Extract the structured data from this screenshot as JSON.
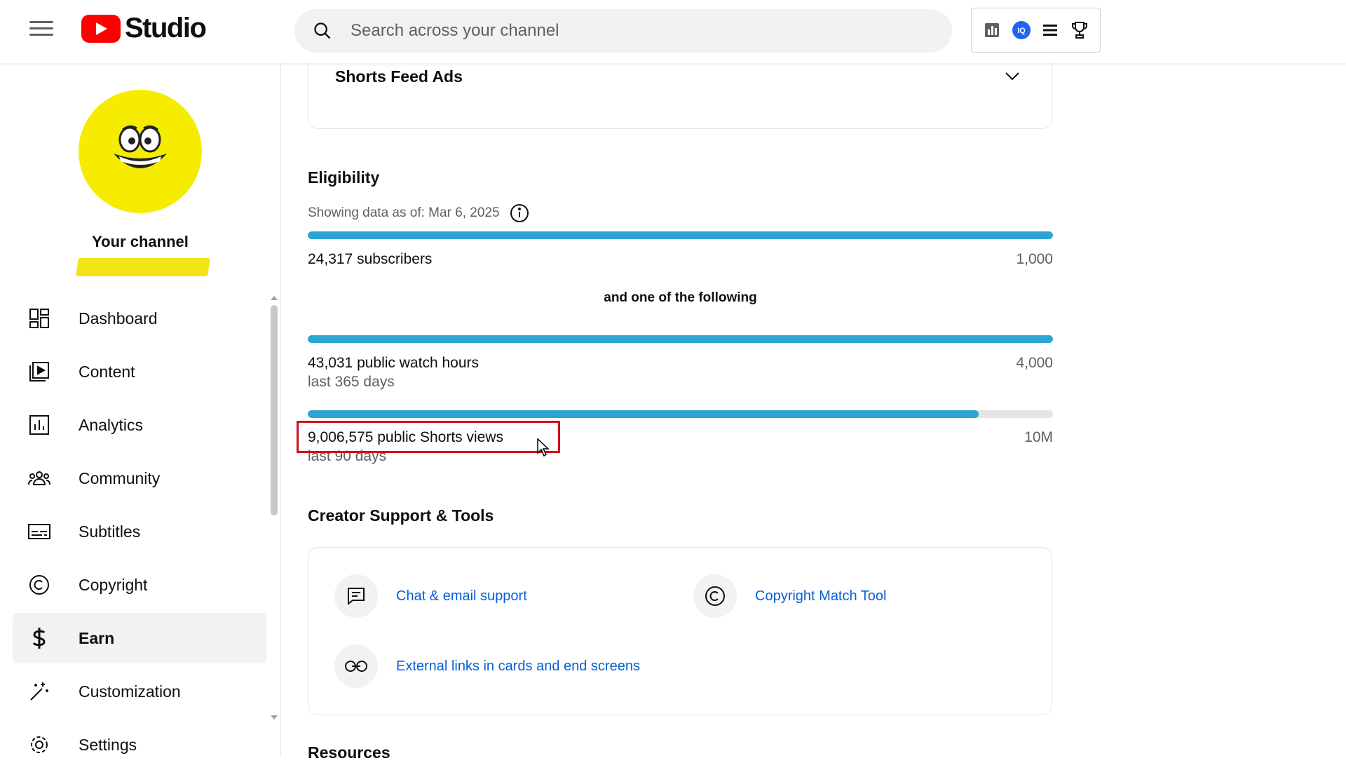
{
  "header": {
    "logo_text": "Studio",
    "search_placeholder": "Search across your channel",
    "extensions": [
      "analytics-chart-icon",
      "vidiq-icon",
      "list-icon",
      "trophy-icon"
    ]
  },
  "sidebar": {
    "channel_label": "Your channel",
    "items": [
      {
        "label": "Dashboard",
        "icon": "dashboard-icon"
      },
      {
        "label": "Content",
        "icon": "content-icon"
      },
      {
        "label": "Analytics",
        "icon": "analytics-icon"
      },
      {
        "label": "Community",
        "icon": "community-icon"
      },
      {
        "label": "Subtitles",
        "icon": "subtitles-icon"
      },
      {
        "label": "Copyright",
        "icon": "copyright-icon"
      },
      {
        "label": "Earn",
        "icon": "dollar-icon",
        "active": true
      },
      {
        "label": "Customization",
        "icon": "magic-wand-icon"
      },
      {
        "label": "Settings",
        "icon": "gear-icon"
      }
    ]
  },
  "main": {
    "shorts_feed_title": "Shorts Feed Ads",
    "eligibility": {
      "title": "Eligibility",
      "as_of": "Showing data as of: Mar 6, 2025",
      "following_label": "and one of the following",
      "metrics": [
        {
          "value_text": "24,317 subscribers",
          "sub": "",
          "target": "1,000",
          "progress": 1.0
        },
        {
          "value_text": "43,031 public watch hours",
          "sub": "last 365 days",
          "target": "4,000",
          "progress": 1.0
        },
        {
          "value_text": "9,006,575 public Shorts views",
          "sub": "last 90 days",
          "target": "10M",
          "progress": 0.9007
        }
      ]
    },
    "creator_support": {
      "title": "Creator Support & Tools",
      "tools": [
        {
          "label": "Chat & email support",
          "icon": "chat-icon"
        },
        {
          "label": "Copyright Match Tool",
          "icon": "copyright-icon"
        },
        {
          "label": "External links in cards and end screens",
          "icon": "link-icon"
        }
      ]
    },
    "resources_title": "Resources"
  },
  "colors": {
    "accent_bar": "#2ba5d1",
    "link": "#065fd4",
    "highlight_box": "#d20f1c",
    "avatar_yellow": "#f5ec00"
  }
}
